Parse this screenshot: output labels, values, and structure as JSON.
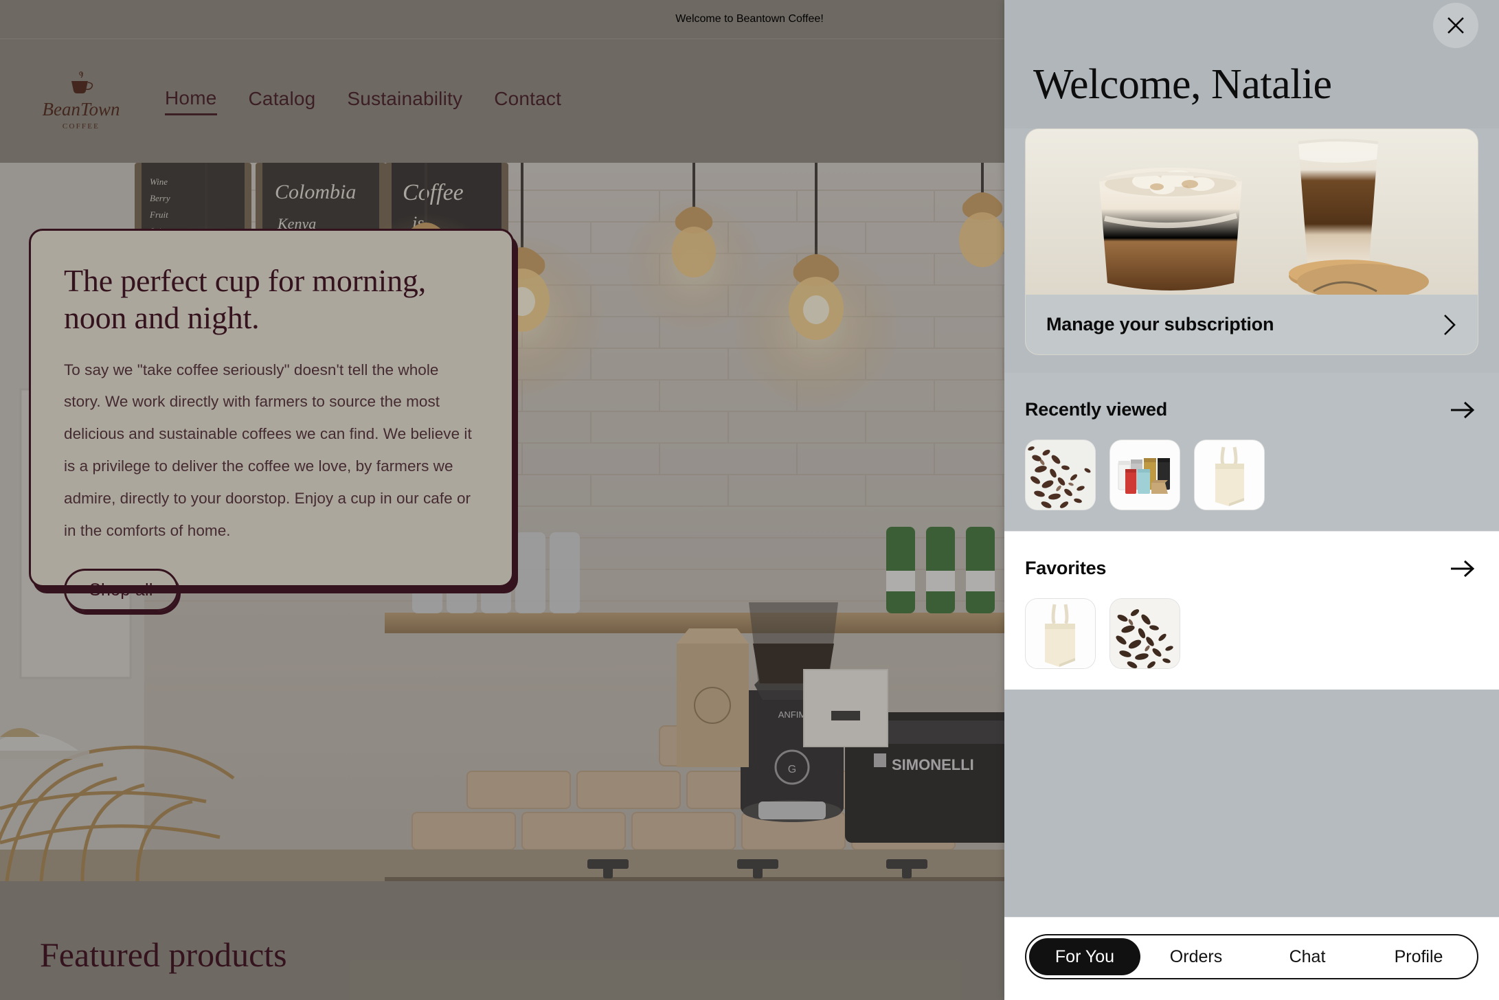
{
  "site": {
    "announcement": "Welcome to Beantown Coffee!",
    "logo": {
      "word": "BeanTown",
      "sub": "COFFEE",
      "icon": "coffee-cup-icon"
    },
    "nav": [
      {
        "label": "Home",
        "active": true
      },
      {
        "label": "Catalog",
        "active": false
      },
      {
        "label": "Sustainability",
        "active": false
      },
      {
        "label": "Contact",
        "active": false
      }
    ],
    "hero": {
      "title": "The perfect cup for morning, noon and night.",
      "body": "To say we \"take coffee seriously\" doesn't tell the whole story. We work directly with farmers to source the most delicious and sustainable coffees we can find. We believe it is a privilege to deliver the coffee we love, by farmers we admire, directly to your doorstop. Enjoy a cup in our cafe or in the comforts of home.",
      "cta": "Shop all"
    },
    "featured_title": "Featured products"
  },
  "panel": {
    "close_icon": "close-icon",
    "greeting": "Welcome, Natalie",
    "subscription": {
      "label": "Manage your subscription",
      "chevron_icon": "chevron-right-icon",
      "image_alt": "iced-coffee-drinks-image"
    },
    "recently_viewed": {
      "title": "Recently viewed",
      "arrow_icon": "arrow-right-icon",
      "items": [
        {
          "name": "cacao-nibs-thumb"
        },
        {
          "name": "coffee-bags-thumb"
        },
        {
          "name": "tote-bag-thumb"
        }
      ]
    },
    "favorites": {
      "title": "Favorites",
      "arrow_icon": "arrow-right-icon",
      "items": [
        {
          "name": "tote-bag-thumb"
        },
        {
          "name": "cacao-nibs-thumb"
        }
      ]
    },
    "tabs": [
      {
        "label": "For You",
        "active": true
      },
      {
        "label": "Orders",
        "active": false
      },
      {
        "label": "Chat",
        "active": false
      },
      {
        "label": "Profile",
        "active": false
      }
    ]
  },
  "colors": {
    "site_bg": "#7c776f",
    "brand_dark": "#3a1420",
    "panel_bg": "#b5bbbf",
    "accent_black": "#111111"
  }
}
